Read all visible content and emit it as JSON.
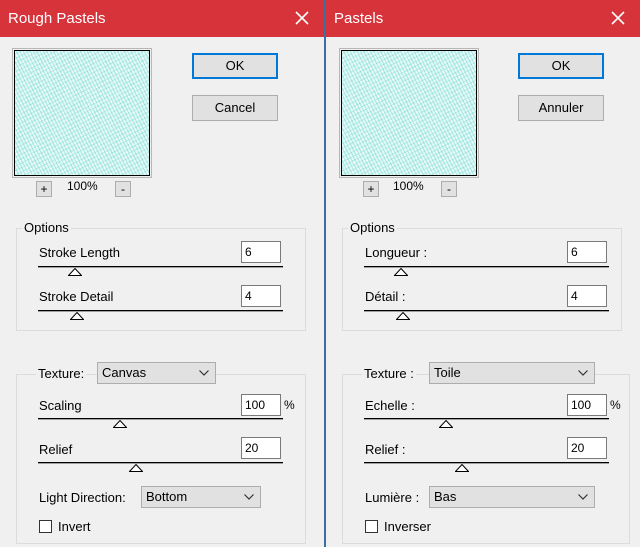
{
  "left": {
    "title": "Rough Pastels",
    "ok_label": "OK",
    "cancel_label": "Cancel",
    "zoom_in": "+",
    "zoom_out": "-",
    "zoom": "100%",
    "options_label": "Options",
    "stroke_length_label": "Stroke Length",
    "stroke_length_value": "6",
    "stroke_detail_label": "Stroke Detail",
    "stroke_detail_value": "4",
    "texture_label": "Texture:",
    "texture_value": "Canvas",
    "scaling_label": "Scaling",
    "scaling_value": "100",
    "percent": "%",
    "relief_label": "Relief",
    "relief_value": "20",
    "light_direction_label": "Light Direction:",
    "light_direction_value": "Bottom",
    "invert_label": "Invert",
    "invert_checked": false
  },
  "right": {
    "title": "Pastels",
    "ok_label": "OK",
    "cancel_label": "Annuler",
    "zoom_in": "+",
    "zoom_out": "-",
    "zoom": "100%",
    "options_label": "Options",
    "stroke_length_label": "Longueur :",
    "stroke_length_value": "6",
    "stroke_detail_label": "Détail :",
    "stroke_detail_value": "4",
    "texture_label": "Texture :",
    "texture_value": "Toile",
    "scaling_label": "Echelle :",
    "scaling_value": "100",
    "percent": "%",
    "relief_label": "Relief :",
    "relief_value": "20",
    "light_direction_label": "Lumière :",
    "light_direction_value": "Bas",
    "invert_label": "Inverser",
    "invert_checked": false
  },
  "colors": {
    "titlebar": "#d7333a",
    "default_button_border": "#0078d7",
    "preview": "#e2f8f6"
  },
  "icons": {
    "close": "close-icon",
    "dropdown": "chevron-down-icon",
    "slider_thumb": "triangle-icon"
  }
}
